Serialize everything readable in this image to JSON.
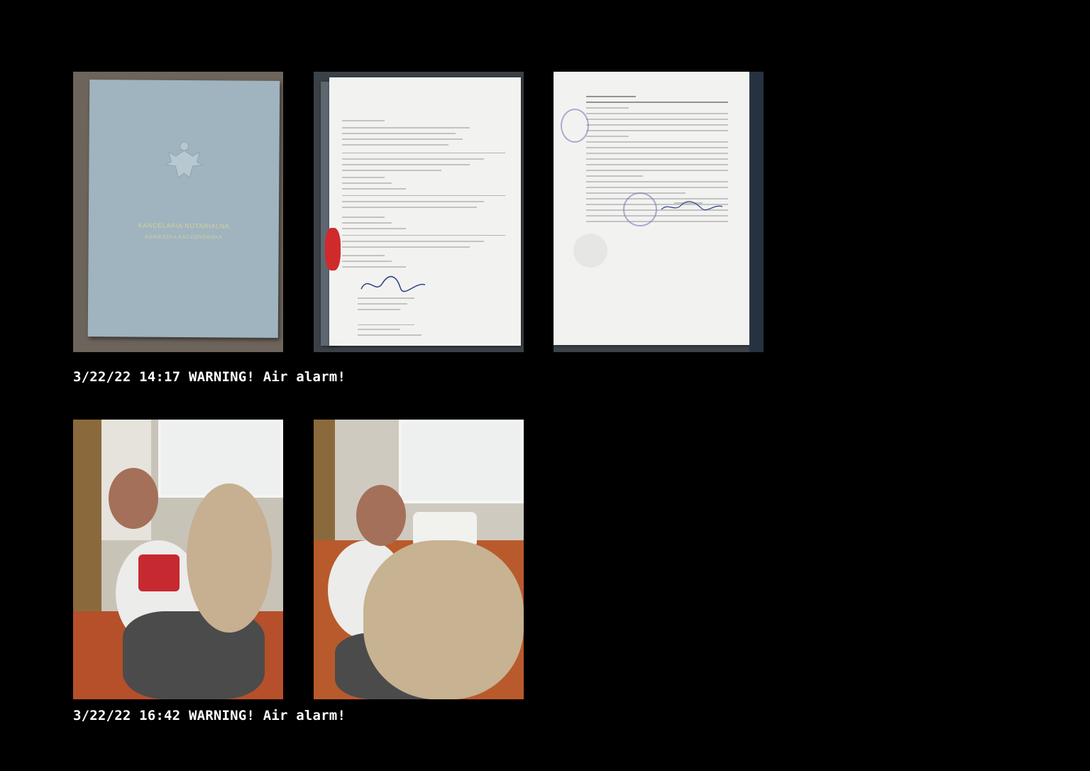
{
  "photos": [
    {
      "subject": "notary folder",
      "cover_line1": "KANCELARIA NOTARIALNA",
      "cover_line2": "AGNIESZKA KACZOROWSKA"
    },
    {
      "subject": "translated document with signature"
    },
    {
      "subject": "notarial certificate page"
    },
    {
      "subject": "man with dog on sofa"
    },
    {
      "subject": "man with dog on sofa, second shot"
    }
  ],
  "captions": [
    "3/22/22 14:17 WARNING! Air alarm!",
    "3/22/22 16:42 WARNING! Air alarm!"
  ],
  "colors": {
    "background": "#000000",
    "caption": "#ffffff"
  }
}
